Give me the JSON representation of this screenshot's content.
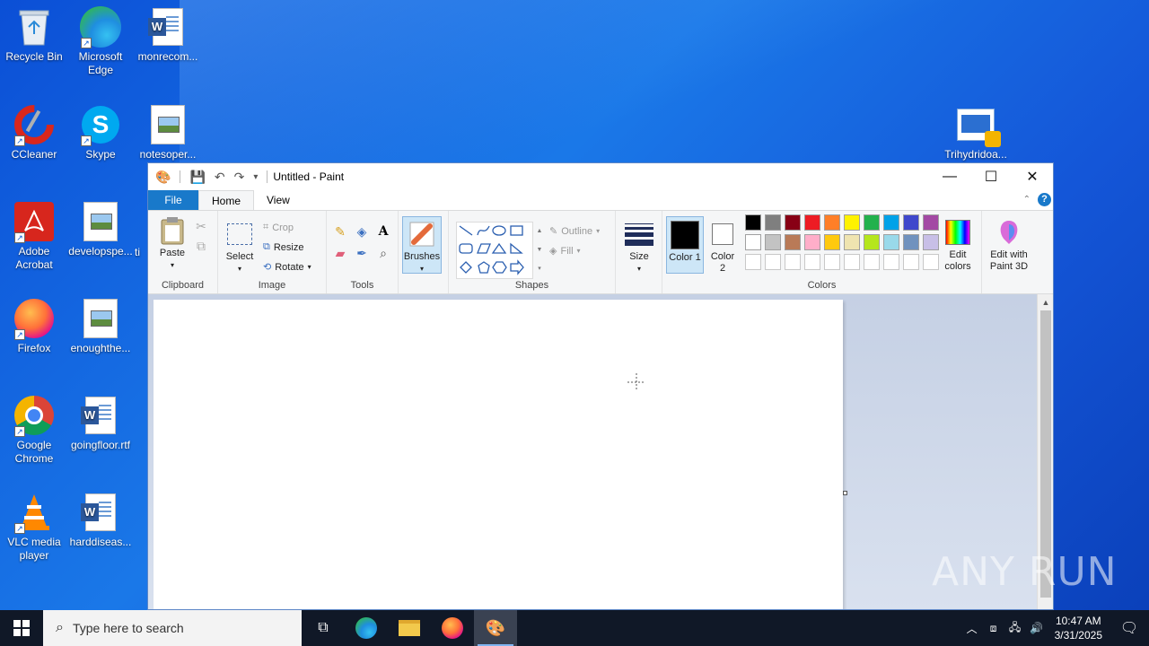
{
  "desktop": {
    "icons": [
      {
        "label": "Recycle Bin"
      },
      {
        "label": "Microsoft Edge"
      },
      {
        "label": "monrecom..."
      },
      {
        "label": "CCleaner"
      },
      {
        "label": "Skype"
      },
      {
        "label": "notesoper..."
      },
      {
        "label": "Adobe Acrobat"
      },
      {
        "label": "developspe..."
      },
      {
        "label": "ti"
      },
      {
        "label": "Firefox"
      },
      {
        "label": "enoughthe..."
      },
      {
        "label": "Google Chrome"
      },
      {
        "label": "goingfloor.rtf"
      },
      {
        "label": "VLC media player"
      },
      {
        "label": "harddiseas..."
      },
      {
        "label": "Trihydridoa..."
      }
    ]
  },
  "paint": {
    "title": "Untitled - Paint",
    "tabs": {
      "file": "File",
      "home": "Home",
      "view": "View"
    },
    "ribbon": {
      "clipboard": {
        "label": "Clipboard",
        "paste": "Paste"
      },
      "image": {
        "label": "Image",
        "select": "Select",
        "crop": "Crop",
        "resize": "Resize",
        "rotate": "Rotate"
      },
      "tools": {
        "label": "Tools"
      },
      "brushes": {
        "label": "Brushes"
      },
      "shapes": {
        "label": "Shapes",
        "outline": "Outline",
        "fill": "Fill"
      },
      "size": {
        "label": "Size"
      },
      "colors": {
        "label": "Colors",
        "color1": "Color 1",
        "color2": "Color 2",
        "edit_colors": "Edit colors",
        "color1_value": "#000000",
        "color2_value": "#ffffff",
        "palette_row1": [
          "#000000",
          "#7f7f7f",
          "#880015",
          "#ed1c24",
          "#ff7f27",
          "#fff200",
          "#22b14c",
          "#00a2e8",
          "#3f48cc",
          "#a349a4"
        ],
        "palette_row2": [
          "#ffffff",
          "#c3c3c3",
          "#b97a57",
          "#ffaec9",
          "#ffc90e",
          "#efe4b0",
          "#b5e61d",
          "#99d9ea",
          "#7092be",
          "#c8bfe7"
        ],
        "palette_row3": [
          "#ffffff",
          "#ffffff",
          "#ffffff",
          "#ffffff",
          "#ffffff",
          "#ffffff",
          "#ffffff",
          "#ffffff",
          "#ffffff",
          "#ffffff"
        ]
      },
      "paint3d": {
        "label": "Edit with Paint 3D"
      }
    }
  },
  "taskbar": {
    "search_placeholder": "Type here to search",
    "time": "10:47 AM",
    "date": "3/31/2025"
  },
  "watermark": "ANY RUN"
}
